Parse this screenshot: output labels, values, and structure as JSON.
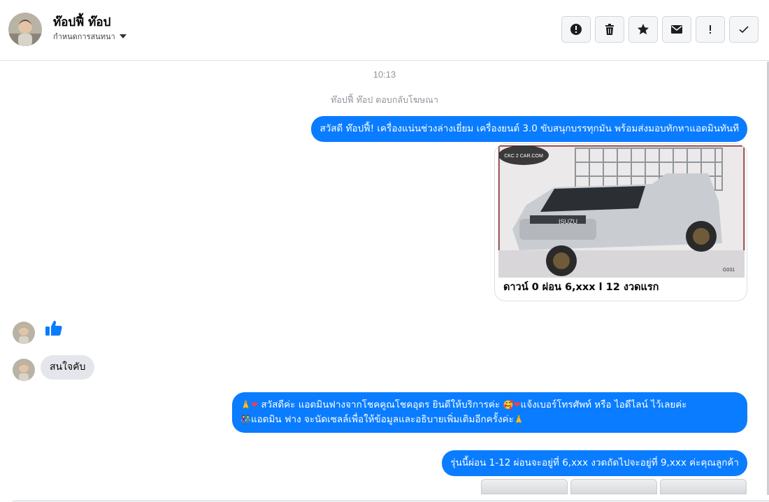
{
  "header": {
    "name": "ท๊อปฟี้ ท๊อป",
    "sub_label": "กำหนดการสนทนา",
    "toolbar": [
      {
        "name": "report-button",
        "icon": "alert-circle-icon"
      },
      {
        "name": "delete-button",
        "icon": "trash-icon"
      },
      {
        "name": "star-button",
        "icon": "star-icon"
      },
      {
        "name": "mark-unread-button",
        "icon": "envelope-icon"
      },
      {
        "name": "important-button",
        "icon": "exclamation-icon"
      },
      {
        "name": "mark-done-button",
        "icon": "check-icon"
      }
    ]
  },
  "thread": {
    "timestamp": "10:13",
    "notice": "ท๊อปฟี้ ท๊อป ตอบกลับโฆษณา",
    "msg1": "สวัสดี ท๊อปฟี้! เครื่องแน่นช่วงล่างเยี่ยม  เครื่องยนต์ 3.0 ขับสนุกบรรทุกมัน พร้อมส่งมอบทักหาแอดมินทันที",
    "card_caption": "ดาวน์ 0 ผ่อน 6,xxx l 12 งวดแรก",
    "card_logo_text": "CKC 2 CAR.COM",
    "card_badge": "G031",
    "card_brand": "ISUZU",
    "reply_text": "สนใจคับ",
    "msg2_line1": "สวัสดีค่ะ แอดมินฟางจากโชคคูณโชคอุดร ยินดีให้บริการค่ะ",
    "msg2_line1b": "แจ้งเบอร์โทรศัพท์ หรือ ไอดีไลน์  ไว้เลยค่ะ",
    "msg2_line2": "แอดมิน ฟาง จะนัดเซลล์เพื่อให้ข้อมูลและอธิบายเพิ่มเติมอีกครั้งค่ะ",
    "msg3": "รุ่นนี้ผ่อน 1-12 ผ่อนจะอยู่ที่ 6,xxx งวดถัดไปจะอยู่ที่ 9,xxx  ค่ะคุณลูกค้า"
  },
  "colors": {
    "accent": "#0a7cff",
    "incoming_bubble": "#e4e6eb"
  }
}
